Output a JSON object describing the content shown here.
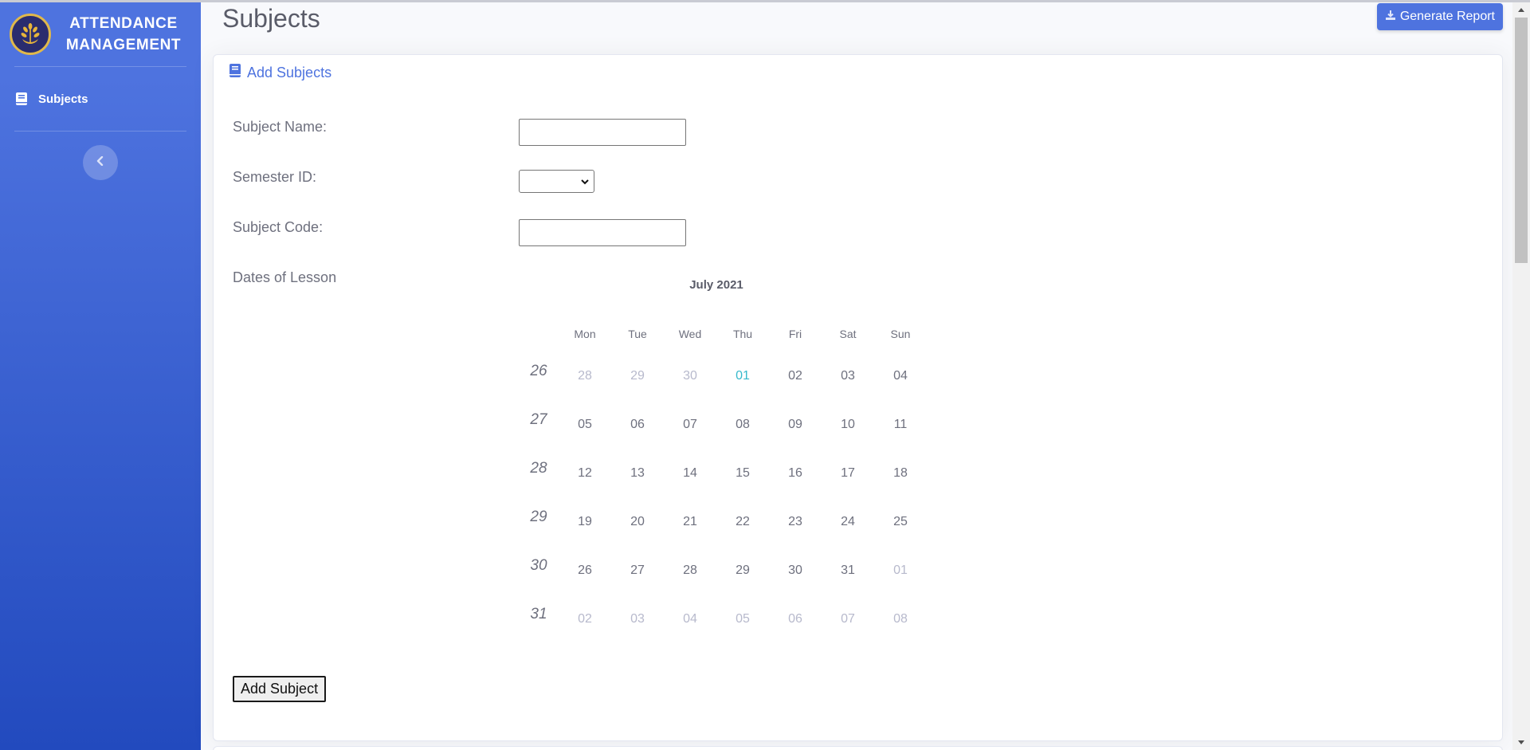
{
  "sidebar": {
    "brand_line1": "ATTENDANCE",
    "brand_line2": "MANAGEMENT",
    "items": [
      {
        "label": "Subjects",
        "icon": "book-icon"
      }
    ],
    "toggle_icon": "chevron-left-icon"
  },
  "header": {
    "title": "Subjects",
    "report_button": "Generate Report",
    "report_icon": "download-icon"
  },
  "form": {
    "card_title": "Add Subjects",
    "card_icon": "book-icon",
    "subject_name_label": "Subject Name:",
    "subject_name_value": "",
    "semester_label": "Semester ID:",
    "semester_value": "",
    "subject_code_label": "Subject Code:",
    "subject_code_value": "",
    "dates_label": "Dates of Lesson",
    "submit": "Add Subject"
  },
  "calendar": {
    "title": "July 2021",
    "day_names": [
      "Mon",
      "Tue",
      "Wed",
      "Thu",
      "Fri",
      "Sat",
      "Sun"
    ],
    "weeks": [
      {
        "week": "26",
        "days": [
          "28",
          "29",
          "30",
          "01",
          "02",
          "03",
          "04"
        ]
      },
      {
        "week": "27",
        "days": [
          "05",
          "06",
          "07",
          "08",
          "09",
          "10",
          "11"
        ]
      },
      {
        "week": "28",
        "days": [
          "12",
          "13",
          "14",
          "15",
          "16",
          "17",
          "18"
        ]
      },
      {
        "week": "29",
        "days": [
          "19",
          "20",
          "21",
          "22",
          "23",
          "24",
          "25"
        ]
      },
      {
        "week": "30",
        "days": [
          "26",
          "27",
          "28",
          "29",
          "30",
          "31",
          "01"
        ]
      },
      {
        "week": "31",
        "days": [
          "02",
          "03",
          "04",
          "05",
          "06",
          "07",
          "08"
        ]
      }
    ],
    "colors": {
      "today": "#36b9cc",
      "other_month": "#b7b9cc",
      "normal": "#6e707e"
    }
  },
  "colors": {
    "primary": "#4e73df",
    "sidebar_bottom": "#224abe"
  }
}
